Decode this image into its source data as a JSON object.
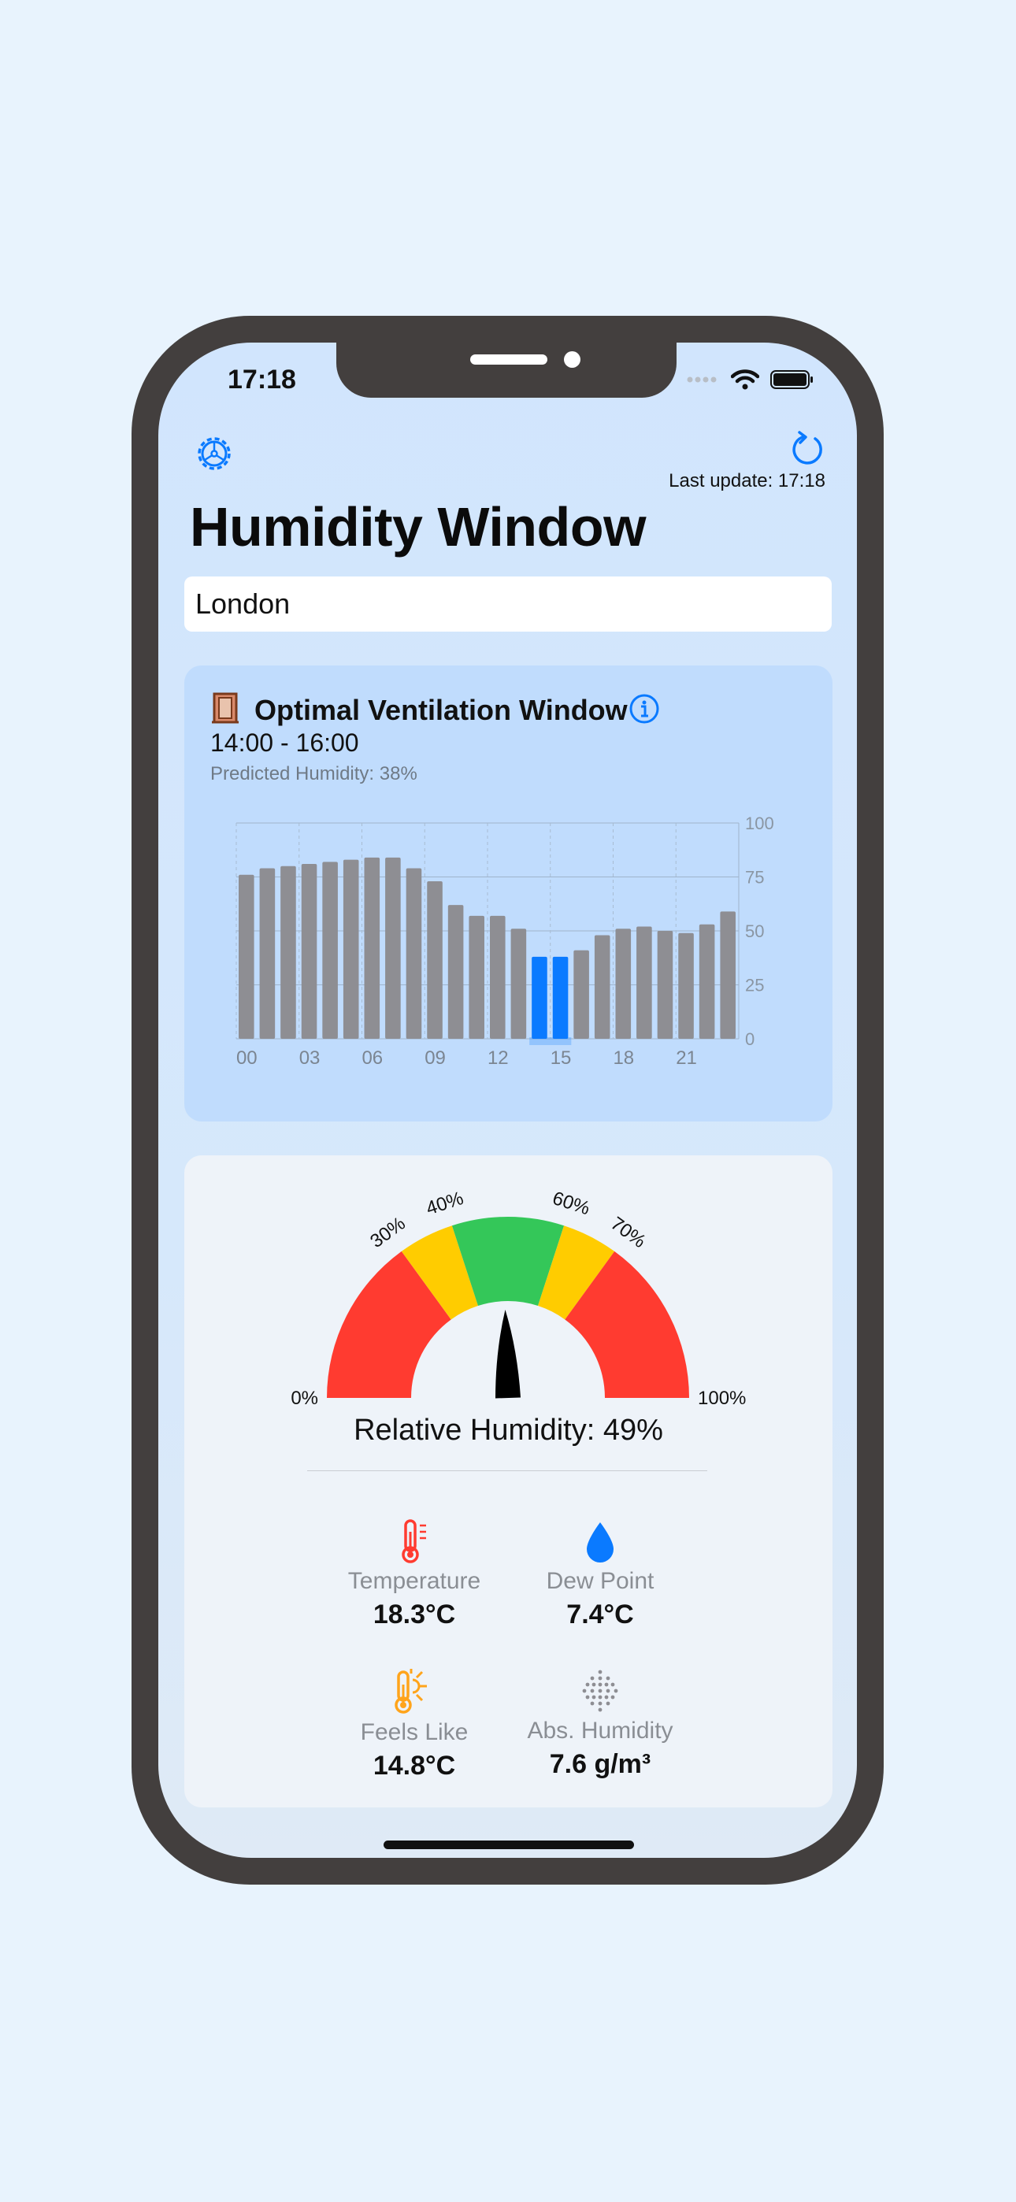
{
  "status_bar": {
    "time": "17:18"
  },
  "header": {
    "last_update": "Last update: 17:18",
    "title": "Humidity Window",
    "location_value": "London"
  },
  "ventilation": {
    "title": "Optimal Ventilation Window",
    "range": "14:00 - 16:00",
    "predicted": "Predicted Humidity: 38%"
  },
  "chart_data": {
    "type": "bar",
    "categories": [
      "00",
      "01",
      "02",
      "03",
      "04",
      "05",
      "06",
      "07",
      "08",
      "09",
      "10",
      "11",
      "12",
      "13",
      "14",
      "15",
      "16",
      "17",
      "18",
      "19",
      "20",
      "21",
      "22",
      "23"
    ],
    "values": [
      76,
      79,
      80,
      81,
      82,
      83,
      84,
      84,
      79,
      73,
      62,
      57,
      57,
      51,
      38,
      38,
      41,
      48,
      51,
      52,
      50,
      49,
      53,
      59
    ],
    "highlight_categories": [
      "14",
      "15"
    ],
    "x_tick_labels": [
      "00",
      "03",
      "06",
      "09",
      "12",
      "15",
      "18",
      "21"
    ],
    "y_tick_labels": [
      "0",
      "25",
      "50",
      "75",
      "100"
    ],
    "ylim": [
      0,
      100
    ],
    "colors": {
      "bar": "#8e8e93",
      "highlight": "#0a7aff"
    }
  },
  "gauge": {
    "value": 49,
    "tick_labels": [
      "0%",
      "30%",
      "40%",
      "60%",
      "70%",
      "100%"
    ],
    "colors": {
      "red": "#ff3b30",
      "yellow": "#ffcc00",
      "green": "#34c759"
    }
  },
  "readout": {
    "relative_humidity": "Relative Humidity: 49%"
  },
  "metrics": [
    {
      "icon": "thermometer-icon",
      "label": "Temperature",
      "value": "18.3°C"
    },
    {
      "icon": "water-drop-icon",
      "label": "Dew Point",
      "value": "7.4°C"
    },
    {
      "icon": "thermometer-sun-icon",
      "label": "Feels Like",
      "value": "14.8°C"
    },
    {
      "icon": "humidity-dots-icon",
      "label": "Abs. Humidity",
      "value": "7.6 g/m³"
    }
  ]
}
